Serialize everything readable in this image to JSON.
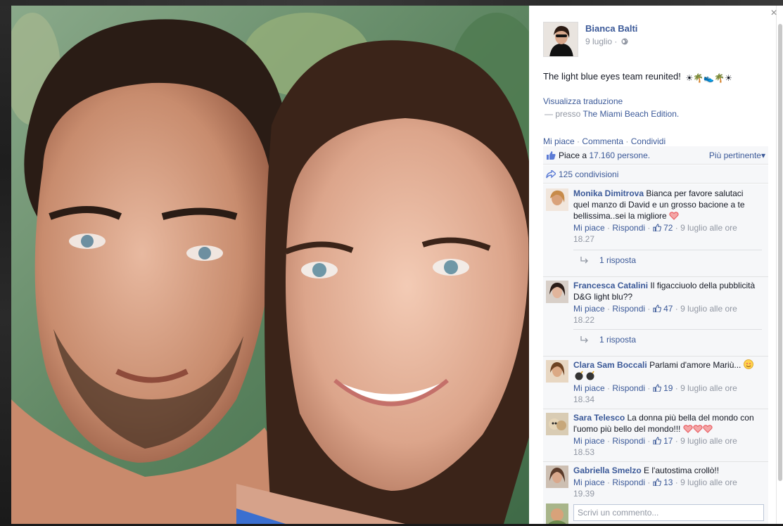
{
  "post": {
    "author": "Bianca Balti",
    "date": "9 luglio",
    "separator": "·",
    "text": "The light blue eyes team reunited!",
    "emojis": [
      "☀",
      "🌴",
      "👟",
      "🌴",
      "☀"
    ],
    "translate_link": "Visualizza traduzione",
    "place_prefix": "— presso",
    "place_name": "The Miami Beach Edition.",
    "close_glyph": "×",
    "audience_icon": "globe-icon"
  },
  "actions": {
    "like": "Mi piace",
    "comment": "Commenta",
    "share": "Condividi",
    "dot": "·"
  },
  "likes": {
    "text_prefix": "Piace a",
    "count": "17.160 persone.",
    "sort_label": "Più pertinente",
    "sort_caret": "▾"
  },
  "shares": {
    "text": "125 condivisioni"
  },
  "comments": [
    {
      "author": "Monika Dimitrova",
      "text_line1": "Bianca per favore salutaci",
      "text_line2": "quel manzo di David e un grosso bacione a te",
      "text_line3": "bellissima..sei la migliore",
      "like_label": "Mi piace",
      "reply_label": "Rispondi",
      "likes": "72",
      "timestamp_a": "9 luglio alle ore",
      "timestamp_b": "18.27",
      "replies": "1 risposta",
      "avatar_color": "#d9a27a"
    },
    {
      "author": "Francesca Catalini",
      "text_line1": "Il figacciuolo della pubblicità",
      "text_line2": "D&G light blu??",
      "like_label": "Mi piace",
      "reply_label": "Rispondi",
      "likes": "47",
      "timestamp_a": "9 luglio alle ore",
      "timestamp_b": "18.22",
      "replies": "1 risposta",
      "avatar_color": "#3a2a24"
    },
    {
      "author": "Clara Sam Boccali",
      "text_line1": "Parlami d'amore Mariù...",
      "like_label": "Mi piace",
      "reply_label": "Rispondi",
      "likes": "19",
      "timestamp_a": "9 luglio alle ore",
      "timestamp_b": "18.34",
      "avatar_color": "#b8875a"
    },
    {
      "author": "Sara Telesco",
      "text_line1": "La donna più bella del mondo con",
      "text_line2": "l'uomo più bello del mondo!!!",
      "like_label": "Mi piace",
      "reply_label": "Rispondi",
      "likes": "17",
      "timestamp_a": "9 luglio alle ore",
      "timestamp_b": "18.53",
      "avatar_color": "#c9b79a"
    },
    {
      "author": "Gabriella Smelzo",
      "text_line1": "E l'autostima crollò!!",
      "like_label": "Mi piace",
      "reply_label": "Rispondi",
      "likes": "13",
      "timestamp_a": "9 luglio alle ore",
      "timestamp_b": "19.39",
      "avatar_color": "#8a6a55"
    }
  ],
  "composer": {
    "placeholder": "Scrivi un commento..."
  },
  "colors": {
    "link": "#3b5998",
    "meta": "#9197a3",
    "panel_bg": "#f6f7f9",
    "heart": "#e9575d"
  }
}
